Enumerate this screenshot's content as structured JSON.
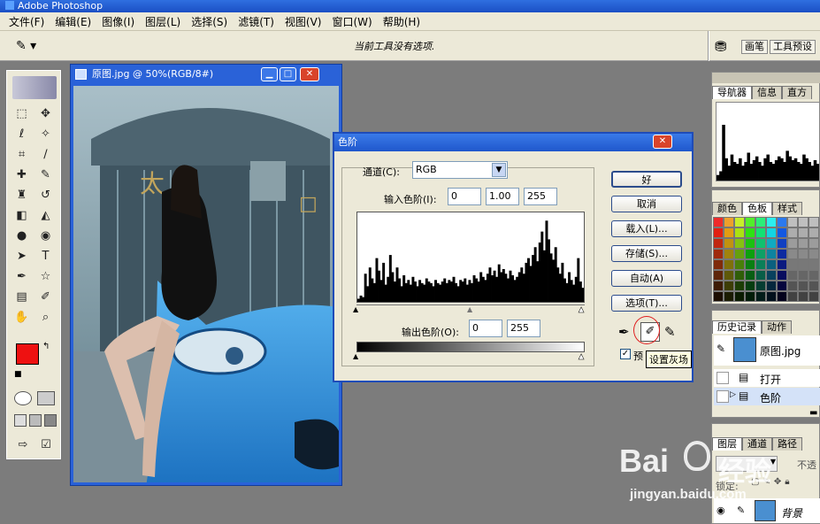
{
  "app": {
    "title": "Adobe Photoshop"
  },
  "menu": [
    "文件(F)",
    "编辑(E)",
    "图像(I)",
    "图层(L)",
    "选择(S)",
    "滤镜(T)",
    "视图(V)",
    "窗口(W)",
    "帮助(H)"
  ],
  "options_bar": {
    "message": "当前工具没有选项.",
    "tabs": [
      "画笔",
      "工具预设"
    ]
  },
  "document": {
    "title": "原图.jpg @ 50%(RGB/8#)"
  },
  "levels": {
    "title": "色阶",
    "channel_label": "通道(C):",
    "channel_value": "RGB",
    "input_label": "输入色阶(I):",
    "input_black": "0",
    "input_gamma": "1.00",
    "input_white": "255",
    "output_label": "输出色阶(O):",
    "output_black": "0",
    "output_white": "255",
    "buttons": {
      "ok": "好",
      "cancel": "取消",
      "load": "载入(L)...",
      "save": "存储(S)...",
      "auto": "自动(A)",
      "options": "选项(T)..."
    },
    "preview_label": "预",
    "tooltip": "设置灰场",
    "histogram": [
      2,
      4,
      3,
      18,
      10,
      22,
      15,
      12,
      28,
      20,
      14,
      25,
      11,
      16,
      30,
      19,
      13,
      22,
      15,
      10,
      17,
      12,
      14,
      11,
      16,
      13,
      10,
      14,
      12,
      11,
      15,
      13,
      12,
      10,
      14,
      12,
      11,
      13,
      15,
      12,
      14,
      13,
      16,
      12,
      10,
      14,
      13,
      15,
      11,
      14,
      12,
      17,
      15,
      13,
      19,
      16,
      14,
      18,
      22,
      17,
      20,
      16,
      24,
      19,
      21,
      18,
      15,
      20,
      17,
      14,
      16,
      19,
      22,
      18,
      25,
      28,
      23,
      30,
      35,
      26,
      38,
      45,
      33,
      52,
      40,
      31,
      27,
      35,
      22,
      18,
      25,
      15,
      12,
      19,
      14,
      11,
      16,
      28,
      13,
      9
    ]
  },
  "navigator": {
    "tabs": [
      "导航器",
      "信息",
      "直方"
    ],
    "histogram": [
      3,
      5,
      30,
      12,
      8,
      14,
      10,
      9,
      12,
      8,
      10,
      15,
      9,
      11,
      13,
      10,
      8,
      12,
      14,
      10,
      9,
      11,
      13,
      12,
      10,
      16,
      13,
      11,
      12,
      10,
      9,
      14,
      12,
      10,
      8,
      11,
      9
    ]
  },
  "swatches": {
    "tabs": [
      "颜色",
      "色板",
      "样式"
    ]
  },
  "history": {
    "tabs": [
      "历史记录",
      "动作"
    ],
    "snapshot": "原图.jpg",
    "items": [
      "打开",
      "色阶"
    ]
  },
  "layers": {
    "tabs": [
      "图层",
      "通道",
      "路径"
    ],
    "opacity_label": "不透",
    "lock_label": "锁定:",
    "layer_name": "背景"
  },
  "watermark": {
    "brand": "Bai",
    "domain": "jingyan.baidu.com"
  }
}
